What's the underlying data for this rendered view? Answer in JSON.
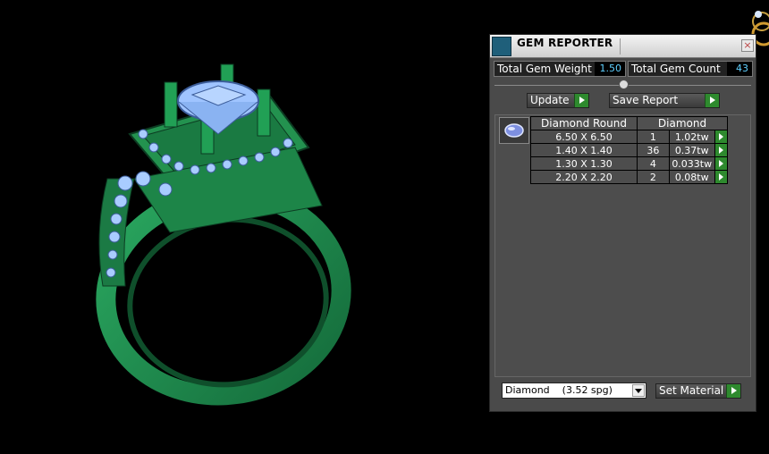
{
  "panel": {
    "title": "GEM REPORTER",
    "close_glyph": "×",
    "total_weight_label": "Total Gem Weight",
    "total_weight_value": "1.50",
    "total_count_label": "Total Gem Count",
    "total_count_value": "43",
    "update_label": "Update",
    "save_report_label": "Save Report",
    "table": {
      "headers": [
        "Diamond Round",
        "Diamond"
      ],
      "rows": [
        {
          "size": "6.50 X 6.50",
          "count": "1",
          "weight": "1.02tw"
        },
        {
          "size": "1.40 X 1.40",
          "count": "36",
          "weight": "0.37tw"
        },
        {
          "size": "1.30 X 1.30",
          "count": "4",
          "weight": "0.033tw"
        },
        {
          "size": "2.20 X 2.20",
          "count": "2",
          "weight": "0.08tw"
        }
      ]
    },
    "material_selected": "Diamond    (3.52 spg)",
    "set_material_label": "Set Material"
  },
  "icons": [
    "ring-wireframe-model",
    "gem-reporter-app-icon",
    "gem-thumbnail-icon",
    "ring-corner-icon"
  ],
  "colors": {
    "model_green": "#1e8a4e",
    "gem_blue": "#9fc4ff",
    "value_text": "#5fd0ff",
    "go_button": "#2e8a2e"
  }
}
